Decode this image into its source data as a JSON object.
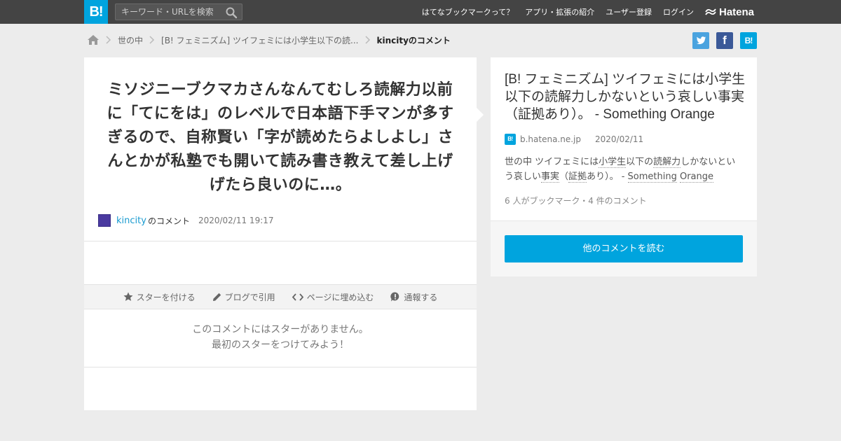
{
  "colors": {
    "brand": "#00a4de",
    "topbar": "#444444",
    "link": "#1a9bd0"
  },
  "header": {
    "logo": "B!",
    "search_placeholder": "キーワード・URLを検索",
    "nav": [
      "はてなブックマークって？",
      "アプリ・拡張の紹介",
      "ユーザー登録",
      "ログイン"
    ],
    "hatena_brand": "Hatena"
  },
  "breadcrumb": {
    "items": [
      "世の中",
      "[B! フェミニズム] ツイフェミには小学生以下の読...",
      "kincityのコメント"
    ]
  },
  "share": {
    "twitter": "twitter-icon",
    "facebook": "f",
    "hatebu": "B!"
  },
  "comment": {
    "text": "ミソジニーブクマカさんなんてむしろ読解力以前に「てにをは」のレベルで日本語下手マンが多すぎるので、自称賢い「字が読めたらよしよし」さんとかが私塾でも開いて読み書き教えて差し上げげたら良いのに…。",
    "user": "kincity",
    "user_suffix": "のコメント",
    "datetime": "2020/02/11 19:17"
  },
  "actions": {
    "star": "スターを付ける",
    "blog": "ブログで引用",
    "embed": "ページに埋め込む",
    "report": "通報する"
  },
  "no_star": {
    "line1": "このコメントにはスターがありません。",
    "line2": "最初のスターをつけてみよう！"
  },
  "entry": {
    "title": "[B! フェミニズム] ツイフェミには小学生以下の読解力しかないという哀しい事実（証拠あり）。 - Something Orange",
    "favicon": "B!",
    "domain": "b.hatena.ne.jp",
    "date": "2020/02/11",
    "description": {
      "p1": "世の中 ツイフェミには",
      "k1": "小学生",
      "p2": "以下の",
      "k2": "読解力",
      "p3": "しかないという哀しい",
      "k3": "事実",
      "p4": "（",
      "k4": "証拠",
      "p5": "あり）。 - ",
      "k5": "Something",
      "p6": " ",
      "k6": "Orange"
    },
    "counts": "6 人がブックマーク・4 件のコメント",
    "read_button": "他のコメントを読む"
  }
}
